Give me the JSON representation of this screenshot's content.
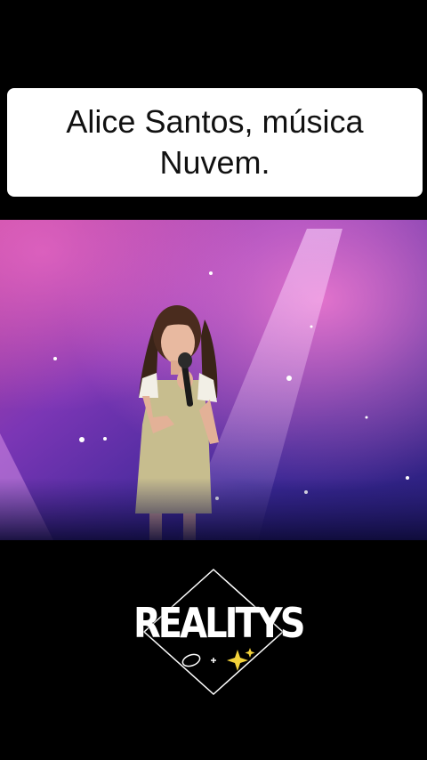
{
  "caption": {
    "line1": "Alice Santos, música",
    "line2": "Nuvem."
  },
  "video": {
    "description_icon": "stage-performer"
  },
  "logo": {
    "text": "REALITYS",
    "icon": "sparkles-icon"
  },
  "colors": {
    "background": "#000000",
    "caption_bg": "#ffffff",
    "stage_purple": "#5a2aa8",
    "stage_pink": "#d65bc0"
  }
}
